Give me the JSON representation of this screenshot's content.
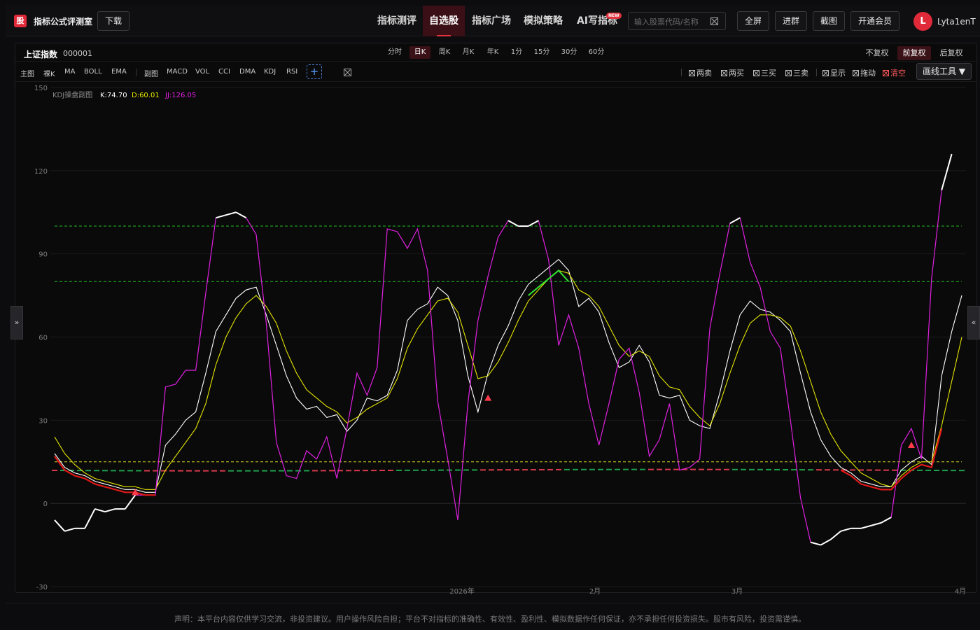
{
  "app": {
    "logo_char": "股",
    "title": "指标公式评测室",
    "download": "下载"
  },
  "nav": [
    {
      "label": "指标测评",
      "active": false
    },
    {
      "label": "自选股",
      "active": true
    },
    {
      "label": "指标广场",
      "active": false
    },
    {
      "label": "模拟策略",
      "active": false
    },
    {
      "label": "AI写指标",
      "active": false
    }
  ],
  "new_badge": "NEW",
  "search": {
    "placeholder": "输入股票代码/名称"
  },
  "top_buttons": [
    "全屏",
    "进群",
    "截图",
    "开通会员"
  ],
  "user": {
    "initial": "L",
    "name": "Lyta1enT"
  },
  "stock": {
    "name": "上证指数",
    "code": "000001"
  },
  "periods": [
    {
      "label": "分时",
      "active": false
    },
    {
      "label": "日K",
      "active": true
    },
    {
      "label": "周K",
      "active": false
    },
    {
      "label": "月K",
      "active": false
    },
    {
      "label": "年K",
      "active": false
    },
    {
      "label": "1分",
      "active": false
    },
    {
      "label": "15分",
      "active": false
    },
    {
      "label": "30分",
      "active": false
    },
    {
      "label": "60分",
      "active": false
    }
  ],
  "adjust": [
    {
      "label": "不复权",
      "active": false
    },
    {
      "label": "前复权",
      "active": true
    },
    {
      "label": "后复权",
      "active": false
    }
  ],
  "main_tools": [
    "主图",
    "裸K",
    "MA",
    "BOLL",
    "EMA"
  ],
  "sub_tools": [
    "副图",
    "MACD",
    "VOL",
    "CCI",
    "DMA",
    "KDJ",
    "RSI"
  ],
  "signals": [
    {
      "label": "两卖",
      "red": false
    },
    {
      "label": "两买",
      "red": false
    },
    {
      "label": "三买",
      "red": false
    },
    {
      "label": "三卖",
      "red": false
    },
    {
      "label": "显示",
      "red": false
    },
    {
      "label": "拖动",
      "red": false
    },
    {
      "label": "清空",
      "red": true
    }
  ],
  "draw_tool": "画线工具 ▼",
  "side_left": "»",
  "side_right": "«",
  "indicator": {
    "name": "KDJ操盘副图",
    "k": "K:74.70",
    "d": "D:60.01",
    "jj": "JJ:126.05"
  },
  "disclaimer": "声明：本平台内容仅供学习交流，非投资建议。用户操作风险自担；平台不对指标的准确性、有效性、盈利性、模拟数据作任何保证，亦不承担任何投资损失。股市有风险，投资需谨慎。",
  "chart_data": {
    "type": "line",
    "y_ticks": [
      150,
      120,
      90,
      60,
      30,
      0,
      -30
    ],
    "ylim": [
      -30,
      150
    ],
    "x_labels": [
      "2026年",
      "2月",
      "3月",
      "4月"
    ],
    "h_lines": [
      {
        "y": 100,
        "color": "#20c020"
      },
      {
        "y": 80,
        "color": "#20c020"
      },
      {
        "y": 15,
        "color": "#d8d820"
      }
    ],
    "colors": {
      "k": "#ffffff",
      "d": "#e6e600",
      "j": "#e020e0"
    },
    "series": [
      {
        "name": "K",
        "values": [
          18,
          13,
          11,
          10,
          8,
          7,
          6,
          5,
          5,
          4,
          4,
          21,
          25,
          30,
          33,
          47,
          62,
          68,
          74,
          77,
          78,
          68,
          57,
          46,
          38,
          34,
          35,
          31,
          32,
          26,
          30,
          38,
          37,
          39,
          48,
          66,
          70,
          72,
          78,
          75,
          66,
          46,
          33,
          47,
          57,
          64,
          73,
          79,
          82,
          85,
          88,
          84,
          71,
          74,
          69,
          58,
          49,
          51,
          57,
          51,
          39,
          38,
          39,
          30,
          28,
          27,
          40,
          55,
          68,
          73,
          70,
          69,
          66,
          62,
          47,
          33,
          23,
          17,
          13,
          11,
          8,
          7,
          6,
          6,
          12,
          15,
          17,
          14,
          46,
          62,
          75
        ]
      },
      {
        "name": "D",
        "values": [
          24,
          18,
          14,
          11,
          9,
          8,
          7,
          6,
          6,
          5,
          5,
          12,
          17,
          22,
          27,
          36,
          50,
          60,
          67,
          72,
          75,
          71,
          65,
          55,
          47,
          41,
          38,
          35,
          33,
          29,
          31,
          34,
          36,
          38,
          45,
          56,
          63,
          68,
          73,
          74,
          69,
          57,
          45,
          46,
          51,
          58,
          66,
          73,
          77,
          81,
          84,
          83,
          77,
          75,
          71,
          64,
          57,
          53,
          55,
          53,
          46,
          42,
          41,
          35,
          31,
          28,
          36,
          47,
          57,
          65,
          68,
          68,
          67,
          64,
          55,
          44,
          33,
          25,
          19,
          15,
          11,
          9,
          7,
          6,
          10,
          13,
          15,
          15,
          28,
          44,
          60
        ]
      },
      {
        "name": "JJ",
        "values": [
          -6,
          -10,
          -9,
          -9,
          -2,
          -3,
          -2,
          -2,
          3,
          3,
          3,
          42,
          43,
          48,
          48,
          76,
          103,
          104,
          105,
          103,
          97,
          65,
          22,
          10,
          9,
          19,
          16,
          24,
          9,
          27,
          47,
          39,
          49,
          99,
          98,
          92,
          99,
          84,
          37,
          16,
          -6,
          36,
          66,
          82,
          96,
          102,
          100,
          100,
          102,
          88,
          57,
          68,
          56,
          36,
          21,
          36,
          52,
          56,
          40,
          17,
          23,
          36,
          12,
          13,
          16,
          63,
          83,
          101,
          103,
          87,
          78,
          62,
          56,
          30,
          2,
          -14,
          -15,
          -13,
          -10,
          -9,
          -9,
          -8,
          -7,
          -5,
          21,
          27,
          16,
          81,
          113,
          126
        ]
      }
    ],
    "thick_line": {
      "start": -12,
      "data": [
        {
          "from": 0,
          "to": 10,
          "values": [
            14,
            11,
            9,
            7,
            8,
            6,
            6,
            5,
            5,
            5,
            5
          ],
          "color": "#e01010",
          "y_as_line": true
        }
      ]
    }
  }
}
